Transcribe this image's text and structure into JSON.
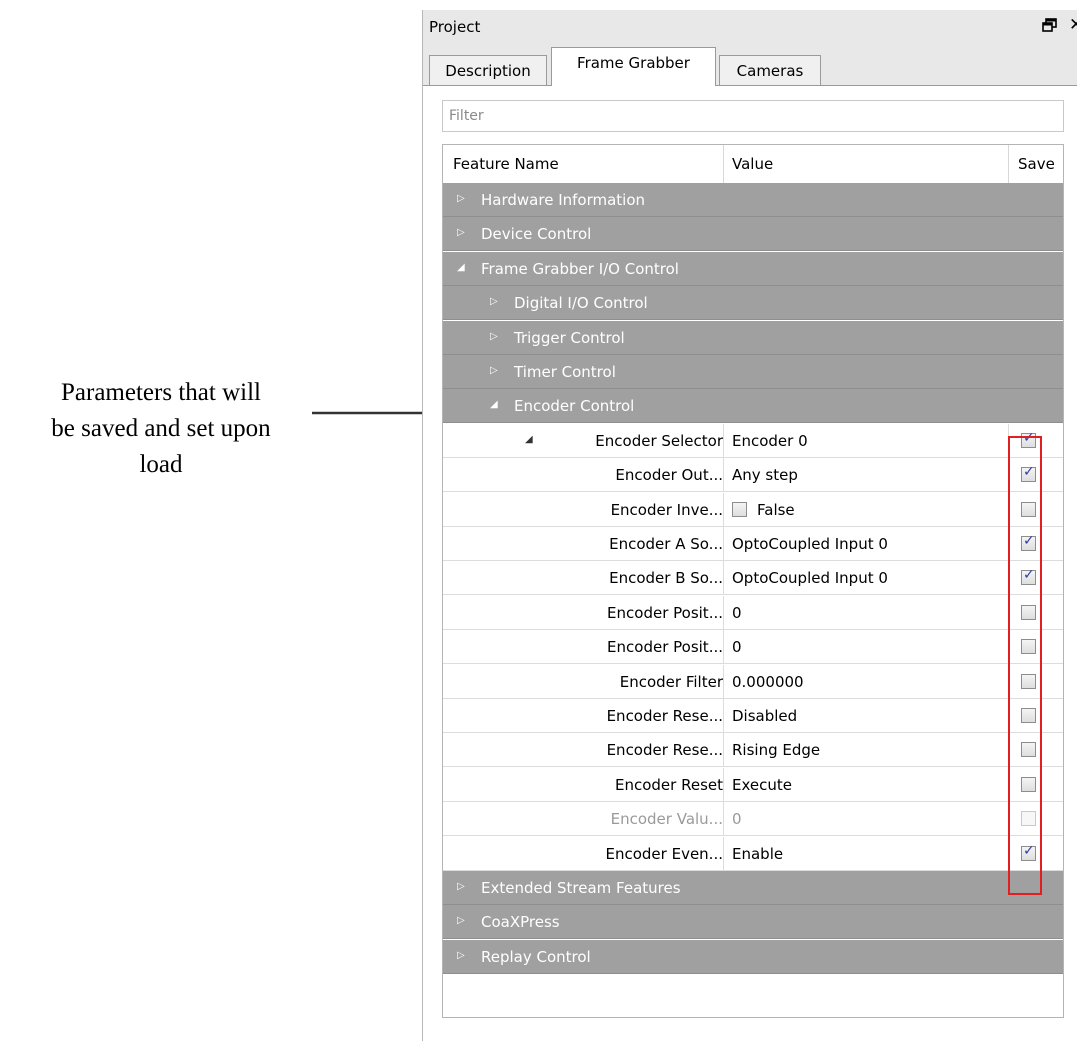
{
  "annotation": {
    "line1": "Parameters that will",
    "line2": "be saved and set upon",
    "line3": "load"
  },
  "panel": {
    "title": "Project",
    "restore_icon": "restore-window-icon",
    "close_glyph": "✕"
  },
  "tabs": [
    {
      "label": "Description",
      "active": false
    },
    {
      "label": "Frame Grabber",
      "active": true
    },
    {
      "label": "Cameras",
      "active": false
    }
  ],
  "filter": {
    "placeholder": "Filter",
    "value": ""
  },
  "grid": {
    "columns": {
      "name": "Feature Name",
      "value": "Value",
      "save": "Save"
    },
    "rows": [
      {
        "type": "category",
        "level": 0,
        "expanded": false,
        "label": "Hardware Information"
      },
      {
        "type": "category",
        "level": 0,
        "expanded": false,
        "label": "Device Control"
      },
      {
        "type": "category",
        "level": 0,
        "expanded": true,
        "label": "Frame Grabber I/O Control"
      },
      {
        "type": "category",
        "level": 1,
        "expanded": false,
        "label": "Digital I/O Control"
      },
      {
        "type": "category",
        "level": 1,
        "expanded": false,
        "label": "Trigger Control"
      },
      {
        "type": "category",
        "level": 1,
        "expanded": false,
        "label": "Timer Control"
      },
      {
        "type": "category",
        "level": 1,
        "expanded": true,
        "label": "Encoder Control"
      },
      {
        "type": "feature",
        "name": "Encoder Selector",
        "value": "Encoder 0",
        "save": true,
        "expandable": true
      },
      {
        "type": "feature",
        "name": "Encoder Out...",
        "value": "Any step",
        "save": true
      },
      {
        "type": "feature",
        "name": "Encoder Inve...",
        "value": "False",
        "value_checkbox": true,
        "value_checked": false,
        "save": false
      },
      {
        "type": "feature",
        "name": "Encoder A So...",
        "value": "OptoCoupled Input 0",
        "save": true
      },
      {
        "type": "feature",
        "name": "Encoder B So...",
        "value": "OptoCoupled Input 0",
        "save": true
      },
      {
        "type": "feature",
        "name": "Encoder Posit...",
        "value": "0",
        "save": false
      },
      {
        "type": "feature",
        "name": "Encoder Posit...",
        "value": "0",
        "save": false
      },
      {
        "type": "feature",
        "name": "Encoder Filter",
        "value": "0.000000",
        "save": false
      },
      {
        "type": "feature",
        "name": "Encoder Rese...",
        "value": "Disabled",
        "save": false
      },
      {
        "type": "feature",
        "name": "Encoder Rese...",
        "value": "Rising Edge",
        "save": false
      },
      {
        "type": "feature",
        "name": "Encoder Reset",
        "value": "Execute",
        "save": false
      },
      {
        "type": "feature",
        "name": "Encoder Valu...",
        "value": "0",
        "save": false,
        "disabled": true
      },
      {
        "type": "feature",
        "name": "Encoder Even...",
        "value": "Enable",
        "save": true
      },
      {
        "type": "category",
        "level": 0,
        "expanded": false,
        "label": "Extended Stream Features"
      },
      {
        "type": "category",
        "level": 0,
        "expanded": false,
        "label": "CoaXPress"
      },
      {
        "type": "category",
        "level": 0,
        "expanded": false,
        "label": "Replay Control"
      }
    ]
  },
  "colors": {
    "category_bg": "#a0a0a0",
    "highlight_box": "#e02020",
    "checkmark": "#2d3da8"
  }
}
